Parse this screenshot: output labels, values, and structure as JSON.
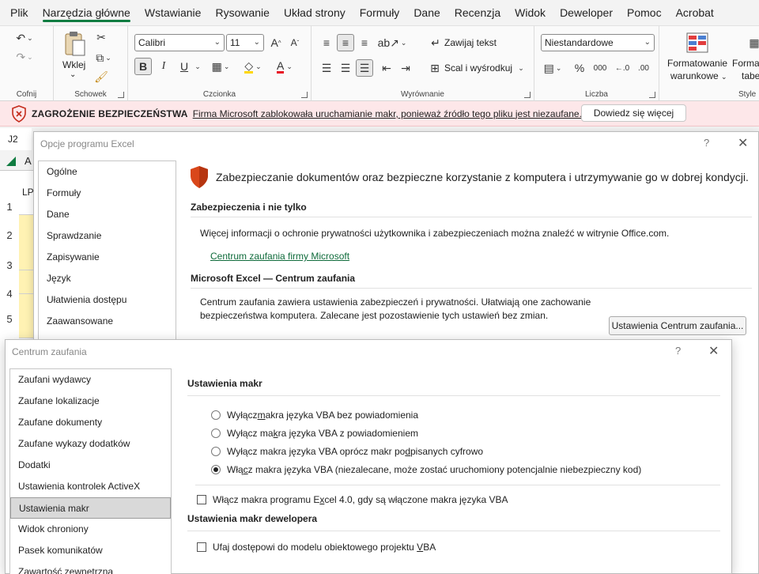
{
  "menu": {
    "items": [
      "Plik",
      "Narzędzia główne",
      "Wstawianie",
      "Rysowanie",
      "Układ strony",
      "Formuły",
      "Dane",
      "Recenzja",
      "Widok",
      "Deweloper",
      "Pomoc",
      "Acrobat"
    ],
    "active_index": 1
  },
  "ribbon": {
    "groups": {
      "undo": "Cofnij",
      "clipboard": "Schowek",
      "font": "Czcionka",
      "alignment": "Wyrównanie",
      "number": "Liczba",
      "styles": "Style"
    },
    "paste_label": "Wklej",
    "font_name": "Calibri",
    "font_size": "11",
    "bold": "B",
    "italic": "I",
    "underline": "U",
    "wrap_text": "Zawijaj tekst",
    "merge_center": "Scal i wyśrodkuj",
    "number_format": "Niestandardowe",
    "cond_format_1": "Formatowanie",
    "cond_format_2": "warunkowe",
    "format_table_1": "Formatuj",
    "format_table_2": "tabe",
    "num_000": "000"
  },
  "security_bar": {
    "title": "ZAGROŻENIE BEZPIECZEŃSTWA",
    "message": "Firma Microsoft zablokowała uruchamianie makr, ponieważ źródło tego pliku jest niezaufane.",
    "button": "Dowiedz się więcej"
  },
  "sheet": {
    "namebox": "J2",
    "col_a": "A",
    "lp": "LP",
    "rows": [
      "1",
      "2",
      "3",
      "4",
      "5"
    ]
  },
  "options_dialog": {
    "title": "Opcje programu Excel",
    "help": "?",
    "nav": [
      "Ogólne",
      "Formuły",
      "Dane",
      "Sprawdzanie",
      "Zapisywanie",
      "Język",
      "Ułatwienia dostępu",
      "Zaawansowane"
    ],
    "heading": "Zabezpieczanie dokumentów oraz bezpieczne korzystanie z komputera i utrzymywanie go w dobrej kondycji.",
    "section1_title": "Zabezpieczenia i nie tylko",
    "section1_text": "Więcej informacji o ochronie prywatności użytkownika i zabezpieczeniach można znaleźć w witrynie Office.com.",
    "section1_link": "Centrum zaufania firmy Microsoft",
    "section2_title": "Microsoft Excel — Centrum zaufania",
    "section2_line1": "Centrum zaufania zawiera ustawienia zabezpieczeń i prywatności. Ułatwiają one zachowanie",
    "section2_line2": "bezpieczeństwa komputera. Zalecane jest pozostawienie tych ustawień bez zmian.",
    "trust_button": "Ustawienia Centrum zaufania..."
  },
  "trust_dialog": {
    "title": "Centrum zaufania",
    "help": "?",
    "nav": [
      "Zaufani wydawcy",
      "Zaufane lokalizacje",
      "Zaufane dokumenty",
      "Zaufane wykazy dodatków",
      "Dodatki",
      "Ustawienia kontrolek ActiveX",
      "Ustawienia makr",
      "Widok chroniony",
      "Pasek komunikatów",
      "Zawartość zewnętrzna"
    ],
    "selected_index": 6,
    "macro_title": "Ustawienia makr",
    "options": [
      {
        "pre": "Wyłącz ",
        "ul": "m",
        "post": "akra języka VBA bez powiadomienia",
        "checked": false
      },
      {
        "pre": "Wyłącz ma",
        "ul": "k",
        "post": "ra języka VBA z powiadomieniem",
        "checked": false
      },
      {
        "pre": "Wyłącz makra języka VBA oprócz makr po",
        "ul": "d",
        "post": "pisanych cyfrowo",
        "checked": false
      },
      {
        "pre": "Włą",
        "ul": "c",
        "post": "z makra języka VBA (niezalecane, może zostać uruchomiony potencjalnie niebezpieczny kod)",
        "checked": true
      }
    ],
    "excel4": {
      "pre": "Włącz makra programu E",
      "ul": "x",
      "post": "cel 4.0, gdy są włączone makra języka VBA"
    },
    "dev_title": "Ustawienia makr dewelopera",
    "vba_access": {
      "pre": "Ufaj dostępowi do modelu obiektowego projektu ",
      "ul": "V",
      "post": "BA"
    }
  }
}
